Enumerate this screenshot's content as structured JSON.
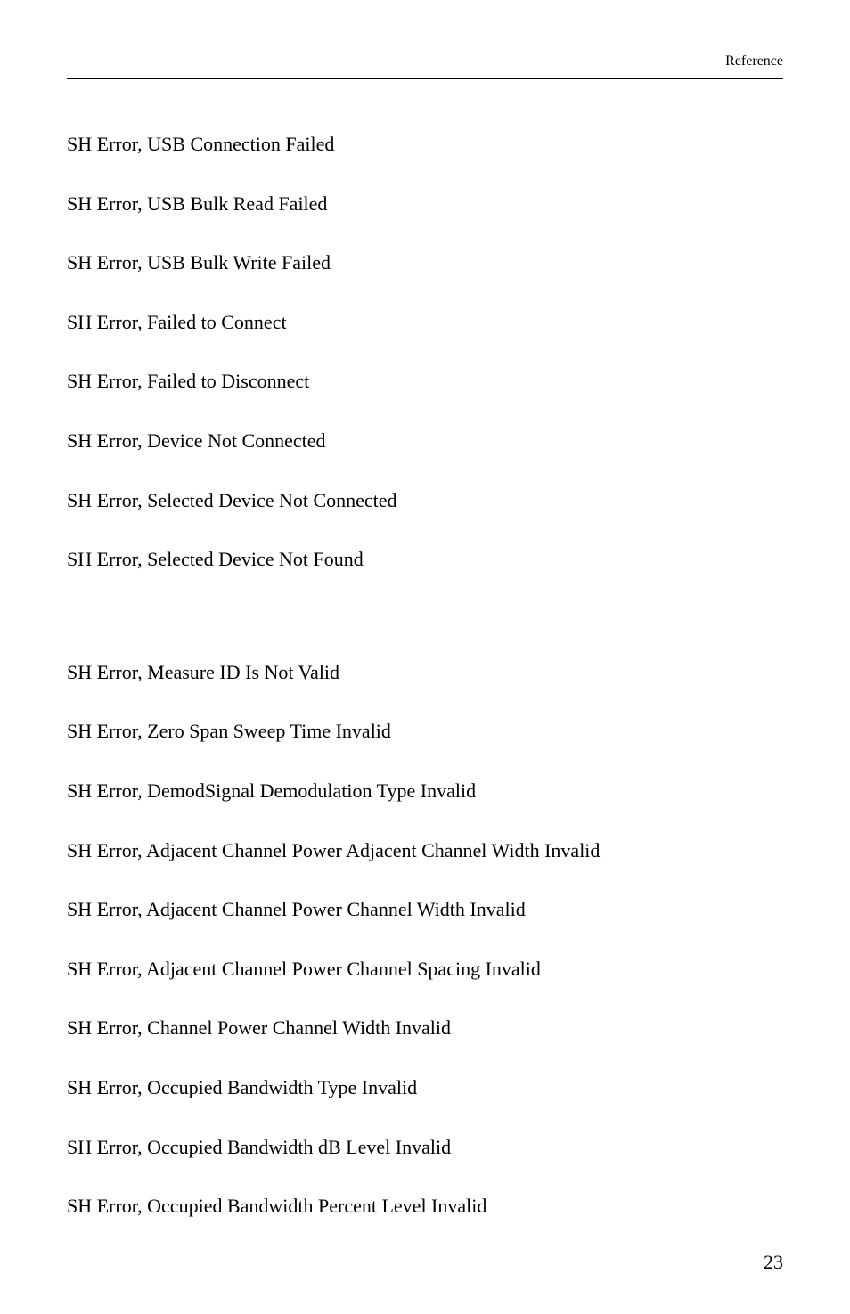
{
  "header": {
    "label": "Reference"
  },
  "errors_group1": [
    "SH Error, USB Connection Failed",
    "SH Error, USB Bulk Read Failed",
    "SH Error, USB Bulk Write Failed",
    "SH Error, Failed to Connect",
    "SH Error, Failed to Disconnect",
    "SH Error, Device Not Connected",
    "SH Error, Selected Device Not Connected",
    "SH Error, Selected Device Not Found"
  ],
  "errors_group2": [
    "SH Error, Measure ID Is Not Valid",
    "SH Error, Zero Span Sweep Time Invalid",
    "SH Error, DemodSignal Demodulation Type Invalid",
    "SH Error, Adjacent Channel Power Adjacent Channel Width Invalid",
    "SH Error, Adjacent Channel Power Channel Width Invalid",
    "SH Error, Adjacent Channel Power Channel Spacing Invalid",
    "SH Error, Channel Power Channel Width Invalid",
    "SH Error, Occupied Bandwidth Type Invalid",
    "SH Error, Occupied Bandwidth dB Level Invalid",
    "SH Error, Occupied Bandwidth Percent Level Invalid"
  ],
  "footer": {
    "page_number": "23"
  }
}
